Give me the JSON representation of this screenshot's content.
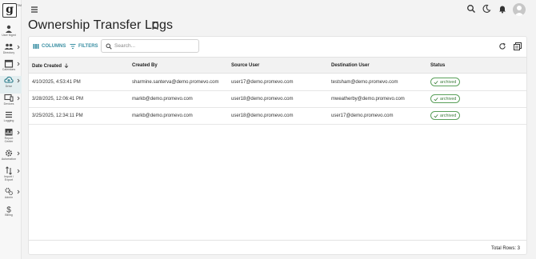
{
  "app": {
    "logo_letter": "g",
    "logo_mark": "TM"
  },
  "sidebar": {
    "items": [
      {
        "label": "User Mgmt",
        "icon": "user-icon",
        "has_submenu": false,
        "active": false
      },
      {
        "label": "Directory",
        "icon": "users-icon",
        "has_submenu": true,
        "active": false
      },
      {
        "label": "Calendars",
        "icon": "calendar-icon",
        "has_submenu": true,
        "active": false
      },
      {
        "label": "Drive",
        "icon": "drive-icon",
        "has_submenu": true,
        "active": true
      },
      {
        "label": "Devices",
        "icon": "devices-icon",
        "has_submenu": true,
        "active": false
      },
      {
        "label": "Logging",
        "icon": "list-icon",
        "has_submenu": false,
        "active": false
      },
      {
        "label": "Report Center",
        "icon": "chart-icon",
        "has_submenu": true,
        "active": false
      },
      {
        "label": "Automation",
        "icon": "gear-icon",
        "has_submenu": true,
        "active": false
      },
      {
        "label": "Import / Export",
        "icon": "import-export-icon",
        "has_submenu": true,
        "active": false
      },
      {
        "label": "Admin",
        "icon": "admin-gears-icon",
        "has_submenu": true,
        "active": false
      },
      {
        "label": "Billing",
        "icon": "dollar-icon",
        "has_submenu": false,
        "active": false
      }
    ]
  },
  "header": {
    "title": "Ownership Transfer Logs"
  },
  "toolbar": {
    "columns_label": "COLUMNS",
    "filters_label": "FILTERS",
    "search_placeholder": "Search..."
  },
  "table": {
    "columns": [
      "Date Created",
      "Created By",
      "Source User",
      "Destination User",
      "Status"
    ],
    "sort": {
      "column": "Date Created",
      "direction": "descending"
    },
    "rows": [
      {
        "date": "4/10/2025, 4:53:41 PM",
        "created_by": "sharmine.santerva@demo.promevo.com",
        "source": "user17@demo.promevo.com",
        "destination": "testsham@demo.promevo.com",
        "status": "archived"
      },
      {
        "date": "3/28/2025, 12:06:41 PM",
        "created_by": "markb@demo.promevo.com",
        "source": "user18@demo.promevo.com",
        "destination": "mweatherby@demo.promevo.com",
        "status": "archived"
      },
      {
        "date": "3/25/2025, 12:34:11 PM",
        "created_by": "markb@demo.promevo.com",
        "source": "user18@demo.promevo.com",
        "destination": "user17@demo.promevo.com",
        "status": "archived"
      }
    ],
    "total_rows_label": "Total Rows: 3"
  },
  "colors": {
    "accent": "#3a8fa3",
    "status_archived": "#3c7d3c",
    "active_nav_bg": "#e3eef0"
  }
}
